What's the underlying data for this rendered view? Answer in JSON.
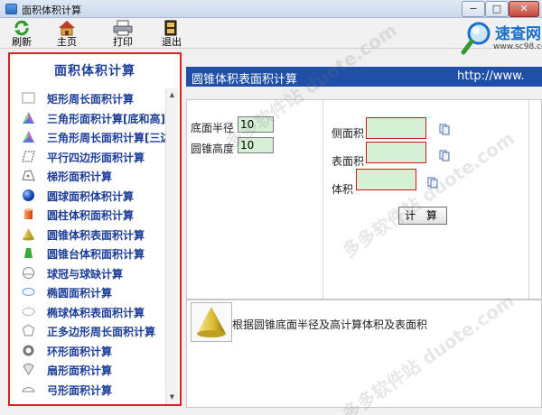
{
  "window": {
    "title": "面积体积计算",
    "min": "−",
    "max": "□",
    "close": "✕"
  },
  "toolbar": {
    "refresh": "刷新",
    "home": "主页",
    "print": "打印",
    "exit": "退出"
  },
  "logo": {
    "name": "速查网",
    "url": "www.sc98.com"
  },
  "sidebar": {
    "title": "面积体积计算",
    "items": [
      {
        "label": "矩形周长面积计算",
        "icon": "rectangle-icon"
      },
      {
        "label": "三角形面积计算[底和高]",
        "icon": "triangle-icon"
      },
      {
        "label": "三角形周长面积计算[三边]",
        "icon": "triangle-icon"
      },
      {
        "label": "平行四边形面积计算",
        "icon": "parallelogram-icon"
      },
      {
        "label": "梯形面积计算",
        "icon": "trapezoid-icon"
      },
      {
        "label": "圆球面积体积计算",
        "icon": "sphere-icon"
      },
      {
        "label": "圆柱体积面积计算",
        "icon": "cylinder-icon"
      },
      {
        "label": "圆锥体积表面积计算",
        "icon": "cone-icon"
      },
      {
        "label": "圆锥台体积面积计算",
        "icon": "frustum-icon"
      },
      {
        "label": "球冠与球缺计算",
        "icon": "spherical-cap-icon"
      },
      {
        "label": "椭圆面积计算",
        "icon": "ellipse-icon"
      },
      {
        "label": "椭球体积表面积计算",
        "icon": "ellipsoid-icon"
      },
      {
        "label": "正多边形周长面积计算",
        "icon": "polygon-icon"
      },
      {
        "label": "环形面积计算",
        "icon": "ring-icon"
      },
      {
        "label": "扇形面积计算",
        "icon": "sector-icon"
      },
      {
        "label": "弓形面积计算",
        "icon": "segment-icon"
      }
    ]
  },
  "main": {
    "header_title": "圆锥体积表面积计算",
    "header_url": "http://www.",
    "inputs": {
      "radius_label": "底面半径",
      "radius_value": "10",
      "height_label": "圆锥高度",
      "height_value": "10"
    },
    "outputs": {
      "lateral_label": "侧面积",
      "surface_label": "表面积",
      "volume_label": "体积"
    },
    "calc_button": "计 算",
    "description": "根据圆锥底面半径及高计算体积及表面积"
  },
  "watermark": "多多软件站 duote.com",
  "colors": {
    "accent": "#1f4fa6",
    "sidebar_text": "#1e3f99",
    "highlight_border": "#e02020",
    "output_fill": "#d6f0d6"
  }
}
